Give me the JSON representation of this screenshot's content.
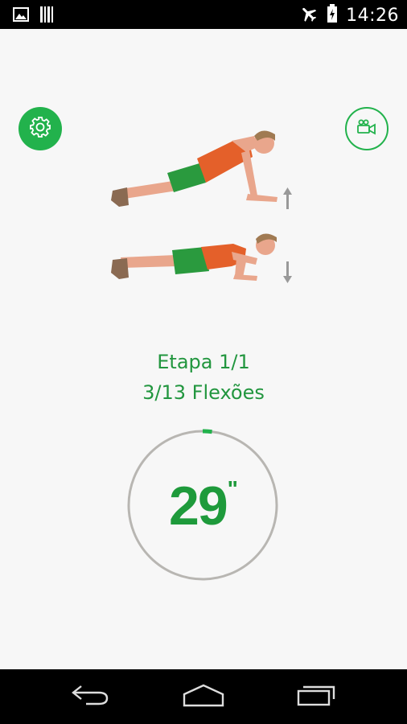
{
  "status_bar": {
    "time": "14:26",
    "icons": [
      "image-notification-icon",
      "barcode-notification-icon",
      "airplane-mode-icon",
      "battery-charging-icon"
    ]
  },
  "toolbar": {
    "settings_icon": "gear-icon",
    "video_icon": "video-camera-icon"
  },
  "workout": {
    "stage": "Etapa 1/1",
    "reps": "3/13 Flexões",
    "timer_value": "29",
    "timer_unit": "\"",
    "progress_fraction": 0.02
  },
  "nav_bar": {
    "icons": [
      "back-icon",
      "home-icon",
      "recent-apps-icon"
    ]
  },
  "colors": {
    "accent": "#22b24c",
    "text_green": "#22963f",
    "ring_gray": "#b8b6b2"
  }
}
